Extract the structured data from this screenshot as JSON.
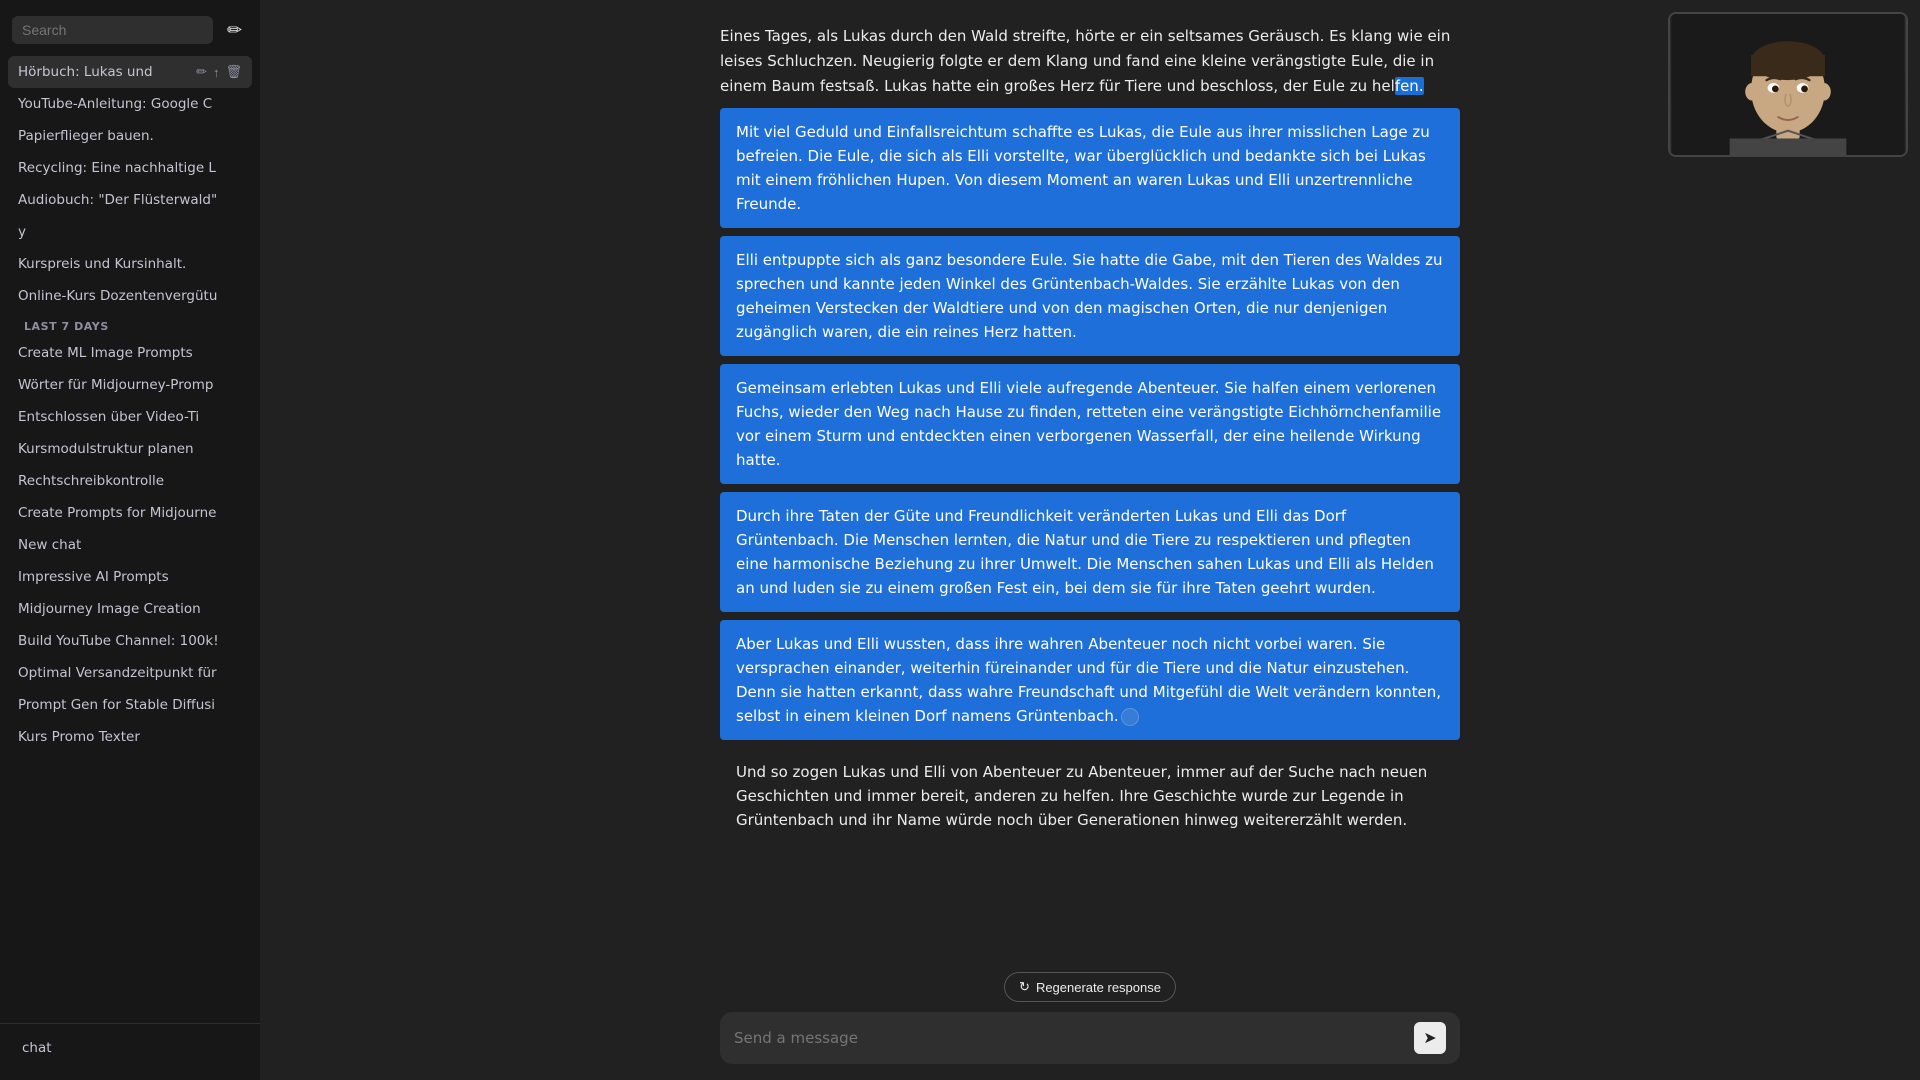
{
  "sidebar": {
    "search_placeholder": "Search",
    "new_chat_icon": "✏",
    "sections": [
      {
        "label": "",
        "items": [
          {
            "id": "active-item",
            "label": "Hörbuch: Lukas und",
            "active": true
          },
          {
            "id": "item-2",
            "label": "YouTube-Anleitung: Google C"
          },
          {
            "id": "item-3",
            "label": "Papierflieger bauen."
          },
          {
            "id": "item-4",
            "label": "Recycling: Eine nachhaltige L"
          },
          {
            "id": "item-5",
            "label": "Audiobuch: \"Der Flüsterwald\""
          },
          {
            "id": "item-6",
            "label": "y"
          },
          {
            "id": "item-7",
            "label": "Kurspreis und Kursinhalt."
          },
          {
            "id": "item-8",
            "label": "Online-Kurs Dozentenvergütu"
          }
        ]
      },
      {
        "label": "Last 7 Days",
        "items": [
          {
            "id": "item-9",
            "label": "Create ML Image Prompts"
          },
          {
            "id": "item-10",
            "label": "Wörter für Midjourney-Promp"
          },
          {
            "id": "item-11",
            "label": "Entschlossen über Video-Ti"
          },
          {
            "id": "item-12",
            "label": "Kursmodulstruktur planen"
          },
          {
            "id": "item-13",
            "label": "Rechtschreibkontrolle"
          },
          {
            "id": "item-14",
            "label": "Create Prompts for Midjourne"
          },
          {
            "id": "item-15",
            "label": "New chat"
          },
          {
            "id": "item-16",
            "label": "Impressive AI Prompts"
          },
          {
            "id": "item-17",
            "label": "Midjourney Image Creation"
          },
          {
            "id": "item-18",
            "label": "Build YouTube Channel: 100k!"
          },
          {
            "id": "item-19",
            "label": "Optimal Versandzeitpunkt für"
          },
          {
            "id": "item-20",
            "label": "Prompt Gen for Stable Diffusi"
          },
          {
            "id": "item-21",
            "label": "Kurs Promo Texter"
          }
        ]
      }
    ],
    "bottom_item": "chat"
  },
  "chat": {
    "paragraphs": [
      {
        "id": "para-1",
        "type": "partial",
        "text_before": "Eines Tages, als Lukas durch den Wald streifte, hörte er ein seltsames Geräusch. Es klang wie ein leises Schluchzen. Neugierig folgte er dem Klang und fand eine kleine verängstigte Eule, die in einem Baum festsaß. Lukas hatte ein großes Herz für Tiere und beschloss, der Eule zu hel",
        "text_highlighted": "fen.",
        "text_after": ""
      },
      {
        "id": "para-2",
        "type": "highlighted",
        "text": "Mit viel Geduld und Einfallsreichtum schaffte es Lukas, die Eule aus ihrer misslichen Lage zu befreien. Die Eule, die sich als Elli vorstellte, war überglücklich und bedankte sich bei Lukas mit einem fröhlichen Hupen. Von diesem Moment an waren Lukas und Elli unzertrennliche Freunde."
      },
      {
        "id": "para-3",
        "type": "highlighted",
        "text": "Elli entpuppte sich als ganz besondere Eule. Sie hatte die Gabe, mit den Tieren des Waldes zu sprechen und kannte jeden Winkel des Grüntenbach-Waldes. Sie erzählte Lukas von den geheimen Verstecken der Waldtiere und von den magischen Orten, die nur denjenigen zugänglich waren, die ein reines Herz hatten."
      },
      {
        "id": "para-4",
        "type": "highlighted",
        "text": "Gemeinsam erlebten Lukas und Elli viele aufregende Abenteuer. Sie halfen einem verlorenen Fuchs, wieder den Weg nach Hause zu finden, retteten eine verängstigte Eichhörnchenfamilie vor einem Sturm und entdeckten einen verborgenen Wasserfall, der eine heilende Wirkung hatte."
      },
      {
        "id": "para-5",
        "type": "highlighted",
        "text": "Durch ihre Taten der Güte und Freundlichkeit veränderten Lukas und Elli das Dorf Grüntenbach. Die Menschen lernten, die Natur und die Tiere zu respektieren und pflegten eine harmonische Beziehung zu ihrer Umwelt. Die Menschen sahen Lukas und Elli als Helden an und luden sie zu einem großen Fest ein, bei dem sie für ihre Taten geehrt wurden."
      },
      {
        "id": "para-6",
        "type": "highlighted",
        "text": "Aber Lukas und Elli wussten, dass ihre wahren Abenteuer noch nicht vorbei waren. Sie versprachen einander, weiterhin füreinander und für die Tiere und die Natur einzustehen. Denn sie hatten erkannt, dass wahre Freundschaft und Mitgefühl die Welt verändern konnten, selbst in einem kleinen Dorf namens Grüntenbach."
      },
      {
        "id": "para-7",
        "type": "normal",
        "text": "Und so zogen Lukas und Elli von Abenteuer zu Abenteuer, immer auf der Suche nach neuen Geschichten und immer bereit, anderen zu helfen. Ihre Geschichte wurde zur Legende in Grüntenbach und ihr Name würde noch über Generationen hinweg weitererzählt werden."
      }
    ],
    "regenerate_label": "Regenerate response",
    "input_placeholder": "Send a message",
    "send_icon": "➤"
  }
}
